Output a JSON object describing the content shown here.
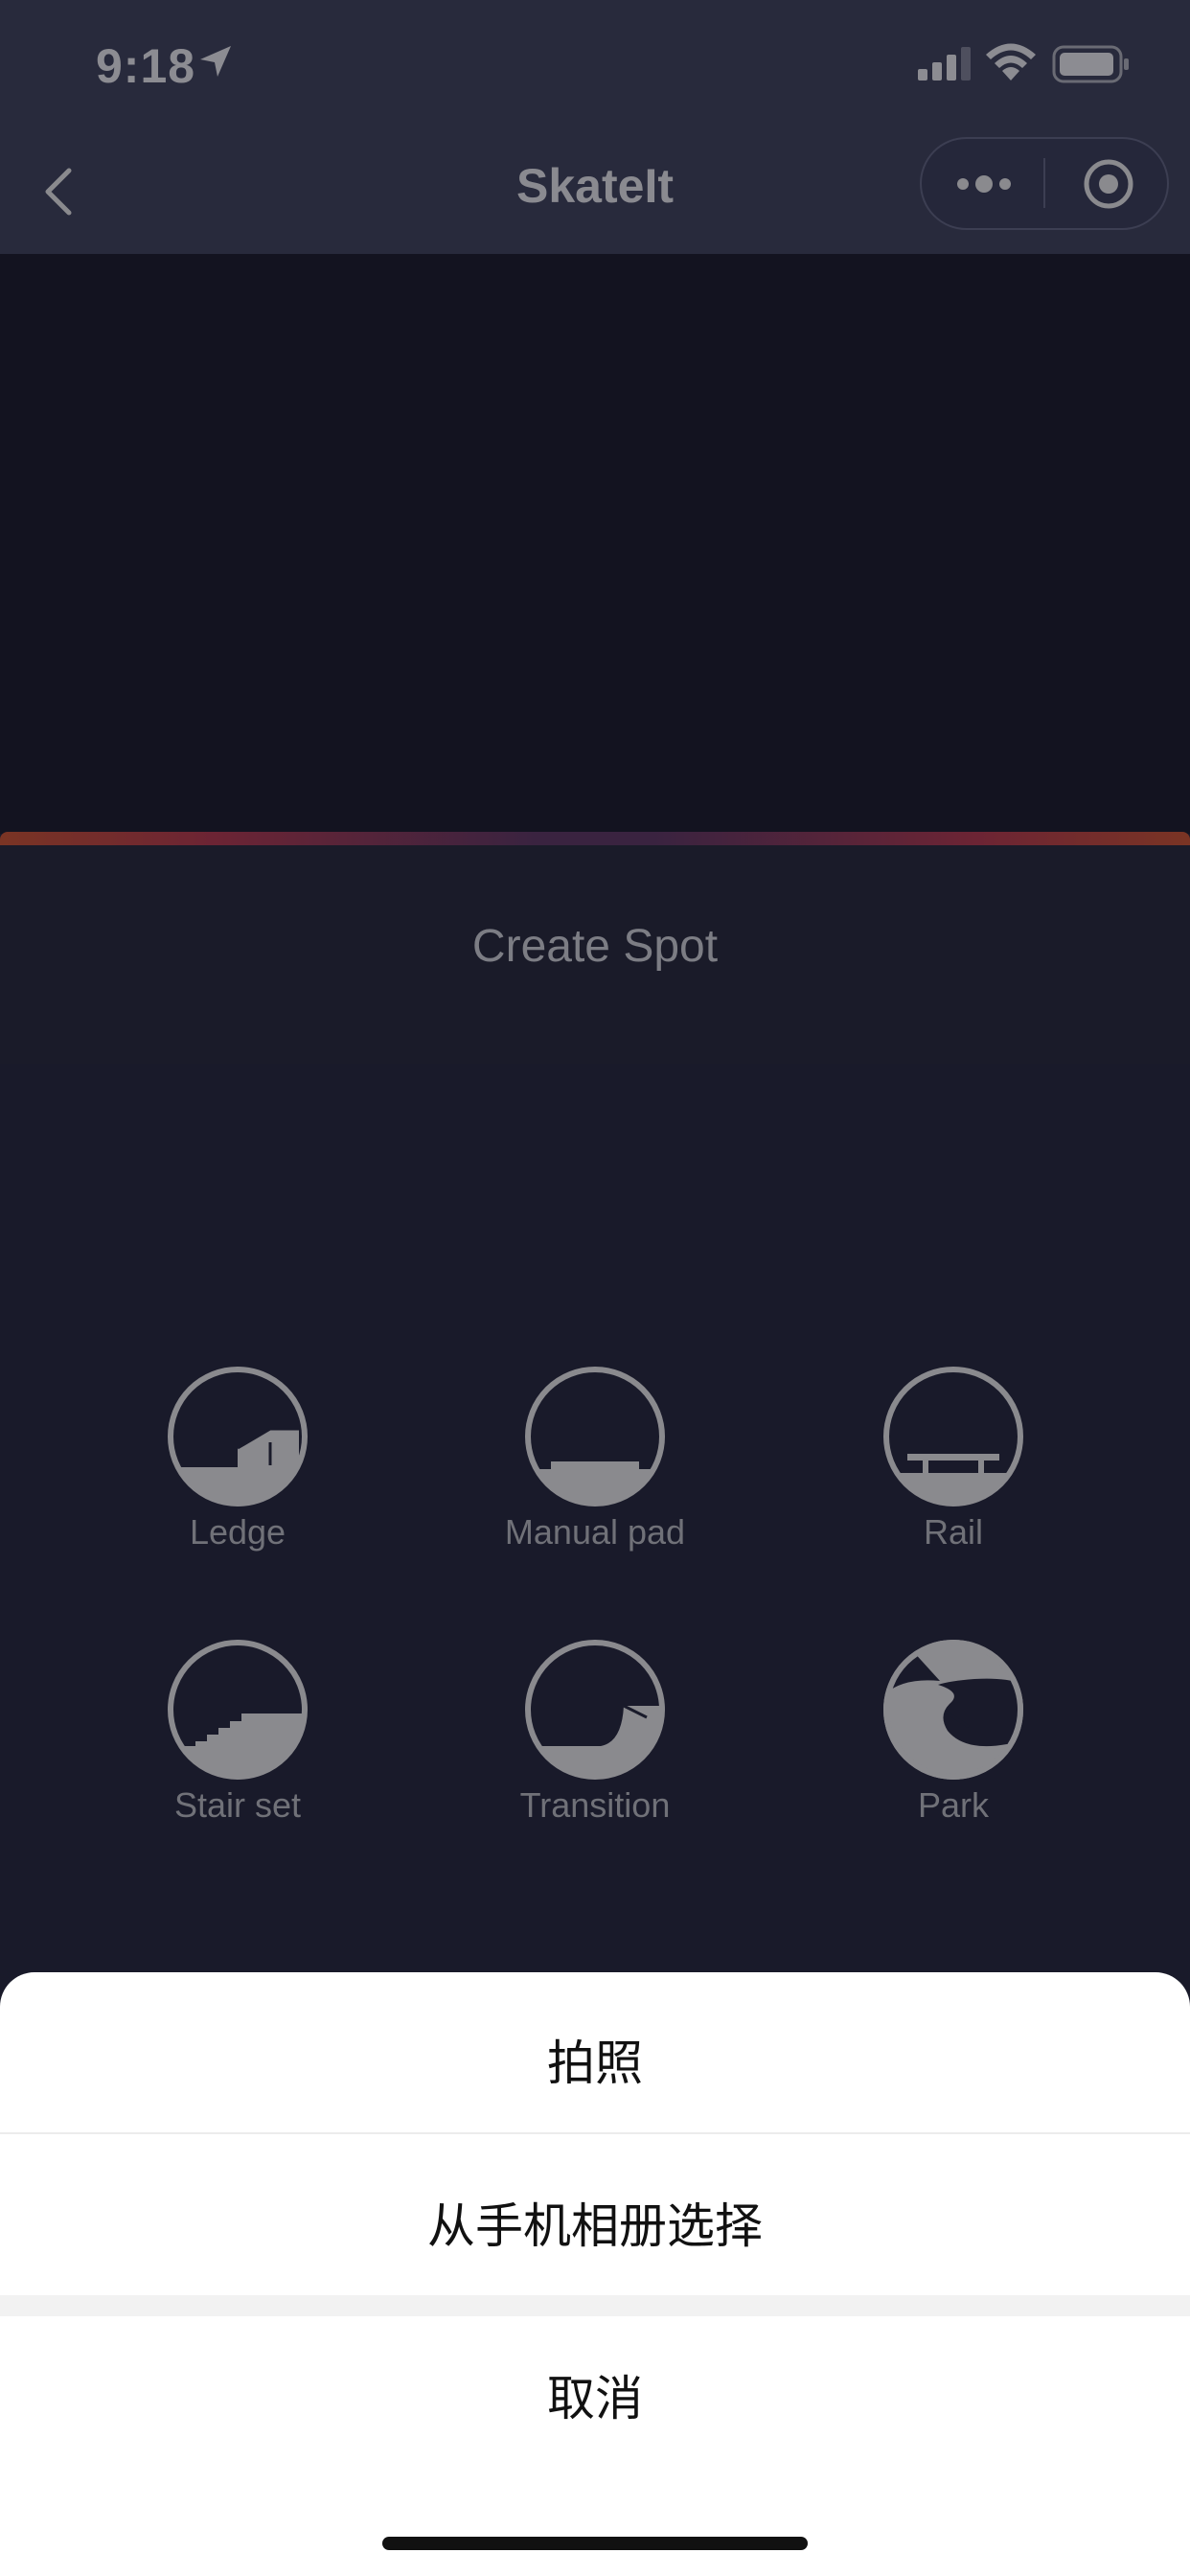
{
  "status_bar": {
    "time": "9:18",
    "icons": [
      "location-arrow-icon",
      "signal-icon",
      "wifi-icon",
      "battery-icon"
    ]
  },
  "nav": {
    "title": "SkateIt",
    "back_icon": "chevron-left-icon",
    "more_icon": "more-dots-icon",
    "close_icon": "target-icon"
  },
  "panel": {
    "title": "Create Spot"
  },
  "spot_types": [
    {
      "label": "Ledge",
      "icon": "ledge-icon"
    },
    {
      "label": "Manual pad",
      "icon": "manual-pad-icon"
    },
    {
      "label": "Rail",
      "icon": "rail-icon"
    },
    {
      "label": "Stair set",
      "icon": "stair-set-icon"
    },
    {
      "label": "Transition",
      "icon": "transition-icon"
    },
    {
      "label": "Park",
      "icon": "park-icon"
    }
  ],
  "action_sheet": {
    "take_photo": "拍照",
    "choose_from_album": "从手机相册选择",
    "cancel": "取消"
  },
  "colors": {
    "background": "#191a2a",
    "nav": "#282a3c",
    "icon_gray": "#8a8a8e",
    "accent_orange": "#7a3424",
    "sheet": "#ffffff"
  }
}
